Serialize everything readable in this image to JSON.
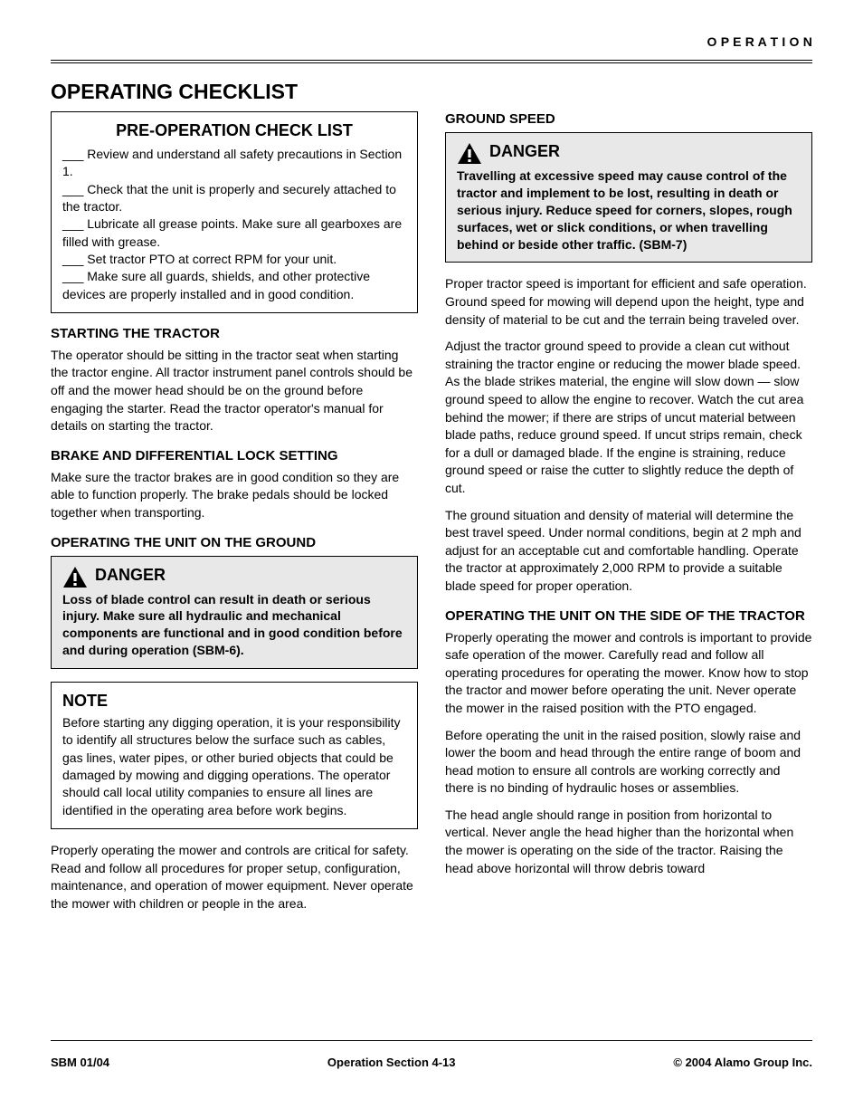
{
  "header": {
    "right": "O P E R A T I O N"
  },
  "title": "OPERATING CHECKLIST",
  "left": {
    "checklist": {
      "title": "PRE-OPERATION CHECK LIST",
      "body": "___ Review and understand all safety precautions in Section 1.\n___ Check that the unit is properly and securely attached to the tractor.\n___ Lubricate all grease points. Make sure all gearboxes are filled with grease.\n___ Set tractor PTO at correct RPM for your unit.\n___ Make sure all guards, shields, and other protective devices are properly installed and in good condition."
    },
    "starting": {
      "h": "STARTING THE TRACTOR",
      "p1": "The operator should be sitting in the tractor seat when starting the tractor engine. All tractor instrument panel controls should be off and the mower head should be on the ground before engaging the starter. Read the tractor operator's manual for details on starting the tractor."
    },
    "brakes": {
      "h": "BRAKE AND DIFFERENTIAL LOCK SETTING",
      "p1": "Make sure the tractor brakes are in good condition so they are able to function properly. The brake pedals should be locked together when transporting."
    },
    "ground": {
      "h": "OPERATING THE UNIT ON THE GROUND",
      "danger": {
        "label": "DANGER",
        "body": "Loss of blade control can result in death or serious injury. Make sure all hydraulic and mechanical components are functional and in good condition before and during operation (SBM-6)."
      },
      "note": {
        "title": "NOTE",
        "body": "Before starting any digging operation, it is your responsibility to identify all structures below the surface such as cables, gas lines, water pipes, or other buried objects that could be damaged by mowing and digging operations. The operator should call local utility companies to ensure all lines are identified in the operating area before work begins."
      },
      "p1": "Properly operating the mower and controls are critical for safety. Read and follow all procedures for proper setup, configuration, maintenance, and operation of mower equipment. Never operate the mower with children or people in the area."
    }
  },
  "right": {
    "speed": {
      "h": "GROUND SPEED",
      "danger": {
        "label": "DANGER",
        "body": "Travelling at excessive speed may cause control of the tractor and implement to be lost, resulting in death or serious injury. Reduce speed for corners, slopes, rough surfaces, wet or slick conditions, or when travelling behind or beside other traffic. (SBM-7)"
      },
      "p1": "Proper tractor speed is important for efficient and safe operation. Ground speed for mowing will depend upon the height, type and density of material to be cut and the terrain being traveled over.",
      "p2": "Adjust the tractor ground speed to provide a clean cut without straining the tractor engine or reducing the mower blade speed. As the blade strikes material, the engine will slow down — slow ground speed to allow the engine to recover. Watch the cut area behind the mower; if there are strips of uncut material between blade paths, reduce ground speed. If uncut strips remain, check for a dull or damaged blade. If the engine is straining, reduce ground speed or raise the cutter to slightly reduce the depth of cut.",
      "p3": "The ground situation and density of material will determine the best travel speed. Under normal conditions, begin at 2 mph and adjust for an acceptable cut and comfortable handling. Operate the tractor at approximately 2,000 RPM to provide a suitable blade speed for proper operation."
    },
    "side": {
      "h": "OPERATING THE UNIT ON THE SIDE OF THE TRACTOR",
      "p1": "Properly operating the mower and controls is important to provide safe operation of the mower. Carefully read and follow all operating procedures for operating the mower. Know how to stop the tractor and mower before operating the unit. Never operate the mower in the raised position with the PTO engaged.",
      "p2": "Before operating the unit in the raised position, slowly raise and lower the boom and head through the entire range of boom and head motion to ensure all controls are working correctly and there is no binding of hydraulic hoses or assemblies.",
      "p3": "The head angle should range in position from horizontal to vertical. Never angle the head higher than the horizontal when the mower is operating on the side of the tractor. Raising the head above horizontal will throw debris toward"
    }
  },
  "footer": {
    "left": "SBM 01/04",
    "center": "Operation Section 4-13",
    "right": "© 2004 Alamo Group Inc."
  }
}
